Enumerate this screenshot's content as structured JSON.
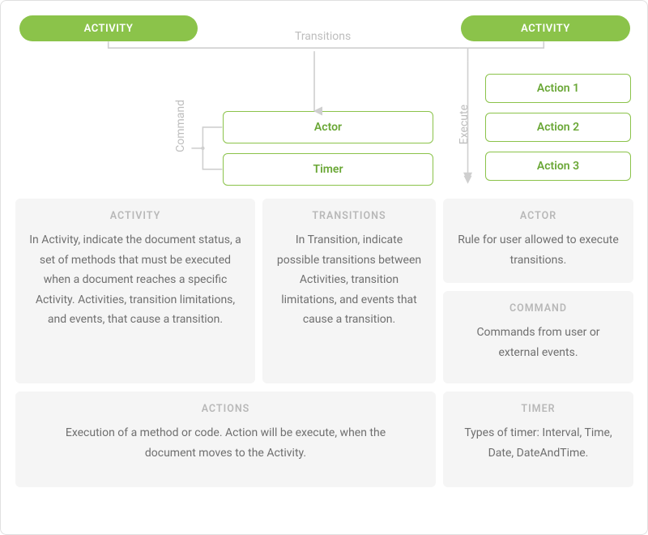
{
  "diagram": {
    "activity_left": "ACTIVITY",
    "activity_right": "ACTIVITY",
    "transitions_label": "Transitions",
    "command_label": "Command",
    "execute_label": "Execute",
    "actor_box": "Actor",
    "timer_box": "Timer",
    "action1": "Action 1",
    "action2": "Action 2",
    "action3": "Action 3"
  },
  "cards": {
    "activity": {
      "title": "ACTIVITY",
      "body": "In Activity, indicate the document status, a set of methods that must be executed when a document reaches a specific Activity. Activities, transition limitations, and events, that cause a transition."
    },
    "transitions": {
      "title": "TRANSITIONS",
      "body": "In Transition, indicate possible transitions between Activities, transition limitations, and events that cause a transition."
    },
    "actor": {
      "title": "ACTOR",
      "body": "Rule for user allowed to execute transitions."
    },
    "command": {
      "title": "COMMAND",
      "body": "Commands from user or external events."
    },
    "actions": {
      "title": "ACTIONS",
      "body": "Execution of a method or code. Action will be execute, when the document moves to the Activity."
    },
    "timer": {
      "title": "TIMER",
      "body": "Types of timer: Interval, Time, Date, DateAndTime."
    }
  },
  "colors": {
    "green": "#8bc34a",
    "green_text": "#6aa736",
    "arrow": "#cfcfcf",
    "card_bg": "#f5f5f5",
    "muted": "#bdbdbd"
  }
}
